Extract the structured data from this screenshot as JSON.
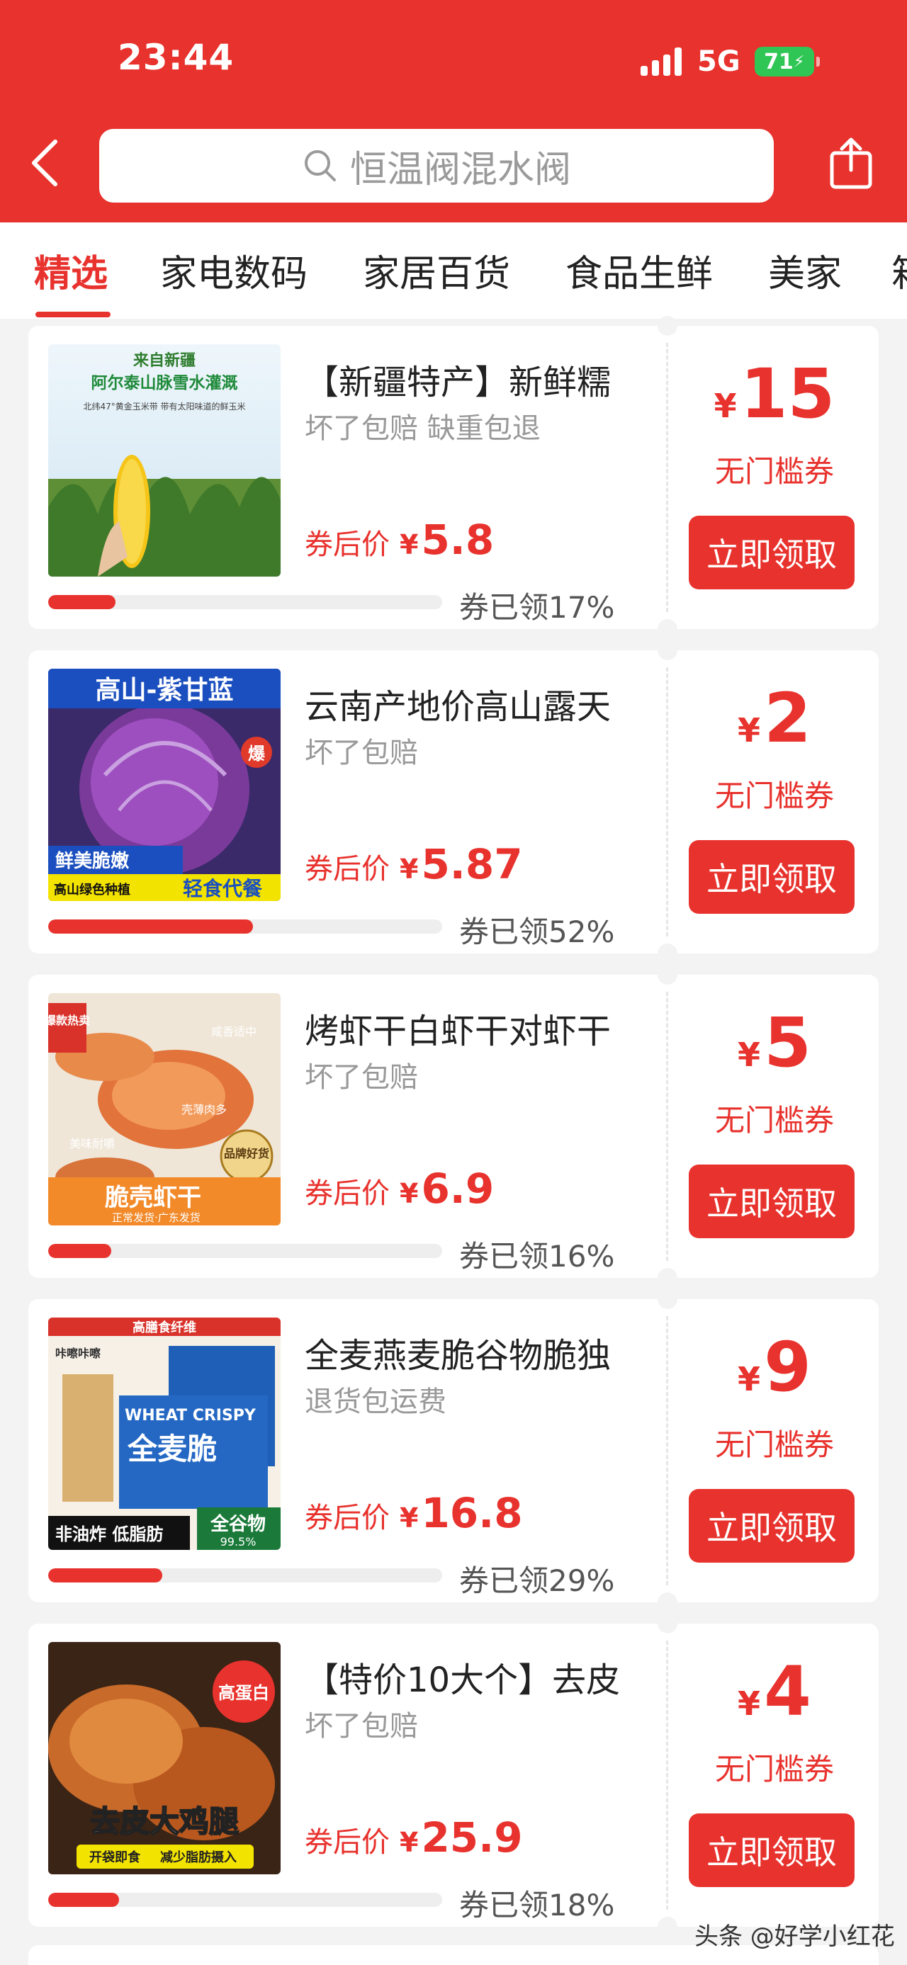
{
  "status_bar": {
    "time": "23:44",
    "network": "5G",
    "battery": "71"
  },
  "search": {
    "query": "恒温阀混水阀"
  },
  "tabs": [
    {
      "label": "精选",
      "active": true
    },
    {
      "label": "家电数码"
    },
    {
      "label": "家居百货"
    },
    {
      "label": "食品生鲜"
    },
    {
      "label": "美家"
    },
    {
      "label": "箱"
    }
  ],
  "products": [
    {
      "title": "【新疆特产】新鲜糯",
      "subtitle": "坏了包赔 缺重包退",
      "price_label": "券后价",
      "currency": "¥",
      "price": "5.8",
      "claimed": "券已领17%",
      "claimed_fraction": 0.17,
      "coupon_amount": "15",
      "coupon_type": "无门槛券",
      "button": "立即领取",
      "image_texts": [
        "来自新疆",
        "阿尔泰山脉雪水灌溉",
        "北纬47°黄金玉米带 带有太阳味道的鲜玉米"
      ]
    },
    {
      "title": "云南产地价高山露天",
      "subtitle": "坏了包赔",
      "price_label": "券后价",
      "currency": "¥",
      "price": "5.87",
      "claimed": "券已领52%",
      "claimed_fraction": 0.52,
      "coupon_amount": "2",
      "coupon_type": "无门槛券",
      "button": "立即领取",
      "image_texts": [
        "高山-紫甘蓝",
        "爆",
        "鲜美脆嫩",
        "高山绿色种植",
        "轻食代餐"
      ]
    },
    {
      "title": "烤虾干白虾干对虾干",
      "subtitle": "坏了包赔",
      "price_label": "券后价",
      "currency": "¥",
      "price": "6.9",
      "claimed": "券已领16%",
      "claimed_fraction": 0.16,
      "coupon_amount": "5",
      "coupon_type": "无门槛券",
      "button": "立即领取",
      "image_texts": [
        "爆款热卖",
        "咸香适中",
        "壳薄肉多",
        "美味耐嚼",
        "品牌好货",
        "脆壳虾干",
        "正常发货·广东发货"
      ]
    },
    {
      "title": "全麦燕麦脆谷物脆独",
      "subtitle": "退货包运费",
      "price_label": "券后价",
      "currency": "¥",
      "price": "16.8",
      "claimed": "券已领29%",
      "claimed_fraction": 0.29,
      "coupon_amount": "9",
      "coupon_type": "无门槛券",
      "button": "立即领取",
      "image_texts": [
        "高膳食纤维",
        "咔嚓咔嚓",
        "WHEAT CRISPY",
        "全麦脆",
        "非油炸 低脂肪",
        "全谷物",
        "99.5%"
      ]
    },
    {
      "title": "【特价10大个】去皮",
      "subtitle": "坏了包赔",
      "price_label": "券后价",
      "currency": "¥",
      "price": "25.9",
      "claimed": "券已领18%",
      "claimed_fraction": 0.18,
      "coupon_amount": "4",
      "coupon_type": "无门槛券",
      "button": "立即领取",
      "image_texts": [
        "高蛋白",
        "去皮大鸡腿",
        "开袋即食",
        "减少脂肪摄入"
      ]
    }
  ],
  "watermark": "头条 @好学小红花",
  "icons": {
    "back": "chevron-left-icon",
    "search": "search-icon",
    "share": "share-icon"
  },
  "colors": {
    "brand_red": "#e8322d",
    "battery_green": "#2fc655"
  }
}
